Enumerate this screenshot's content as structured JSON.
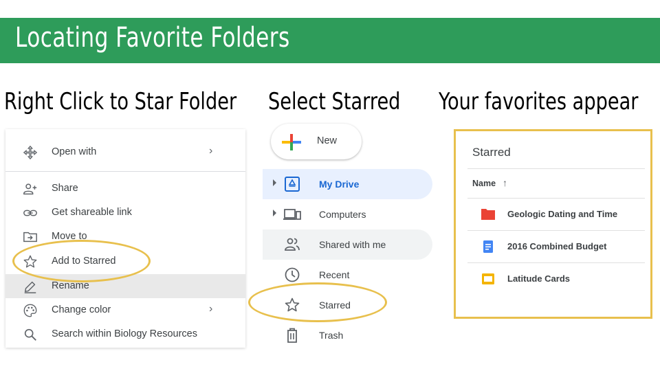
{
  "slide": {
    "title": "Locating Favorite Folders"
  },
  "headings": {
    "step1": "Right Click to Star Folder",
    "step2": "Select Starred",
    "step3": "Your favorites appear"
  },
  "context_menu": {
    "items": [
      {
        "label": "Open with",
        "icon": "open-with-icon",
        "submenu": true
      },
      {
        "label": "Share",
        "icon": "person-add-icon",
        "submenu": false
      },
      {
        "label": "Get shareable link",
        "icon": "link-icon",
        "submenu": false
      },
      {
        "label": "Move to",
        "icon": "move-to-folder-icon",
        "submenu": false
      },
      {
        "label": "Add to Starred",
        "icon": "star-outline-icon",
        "submenu": false
      },
      {
        "label": "Rename",
        "icon": "pencil-icon",
        "submenu": false
      },
      {
        "label": "Change color",
        "icon": "palette-icon",
        "submenu": true
      },
      {
        "label": "Search within Biology Resources",
        "icon": "search-icon",
        "submenu": false
      }
    ],
    "chevron": "›"
  },
  "drive_nav": {
    "new_label": "New",
    "items": [
      {
        "label": "My Drive",
        "icon": "drive-icon",
        "expandable": true,
        "state": "active"
      },
      {
        "label": "Computers",
        "icon": "computers-icon",
        "expandable": true,
        "state": "normal"
      },
      {
        "label": "Shared with me",
        "icon": "shared-people-icon",
        "expandable": false,
        "state": "hover"
      },
      {
        "label": "Recent",
        "icon": "clock-icon",
        "expandable": false,
        "state": "normal"
      },
      {
        "label": "Starred",
        "icon": "star-outline-icon",
        "expandable": false,
        "state": "normal"
      },
      {
        "label": "Trash",
        "icon": "trash-icon",
        "expandable": false,
        "state": "normal"
      }
    ]
  },
  "starred_panel": {
    "title": "Starred",
    "column_header": "Name",
    "sort_icon": "↑",
    "files": [
      {
        "name": "Geologic Dating and Time",
        "icon": "folder-red-icon"
      },
      {
        "name": "2016 Combined Budget",
        "icon": "google-docs-icon"
      },
      {
        "name": "Latitude Cards",
        "icon": "google-slides-icon"
      }
    ]
  },
  "colors": {
    "title_bar": "#2e9c5a",
    "highlight": "#e8c04d",
    "active_blue": "#1967d2",
    "folder_red": "#ea4335",
    "docs_blue": "#4285f4",
    "slides_yellow": "#f4b400"
  }
}
